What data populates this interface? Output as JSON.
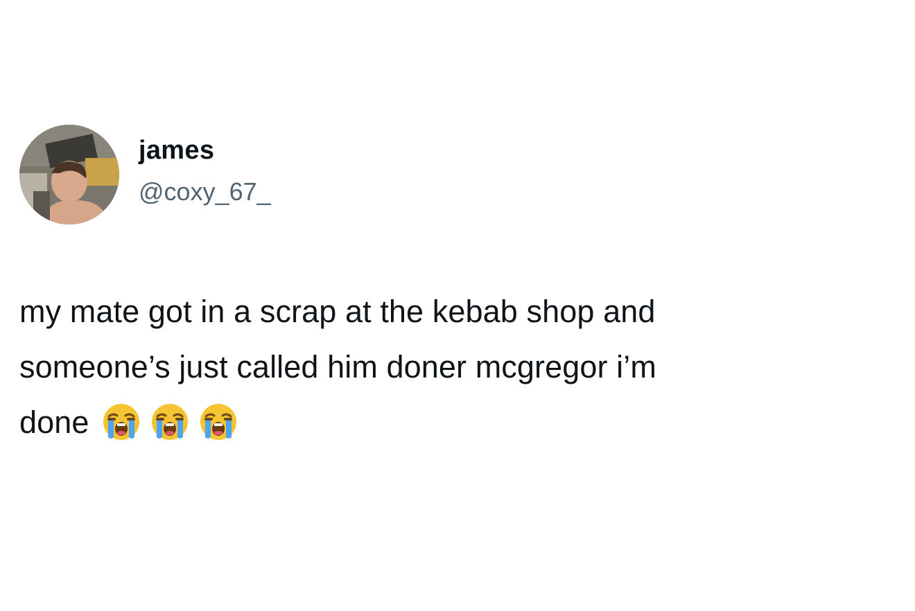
{
  "tweet": {
    "author": {
      "display_name": "james",
      "handle": "@coxy_67_"
    },
    "text_lines": [
      "my mate got in a scrap at the kebab shop and",
      "someone’s just called him doner mcgregor i’m",
      "done"
    ],
    "emojis": [
      "loudly-crying-face",
      "loudly-crying-face",
      "loudly-crying-face"
    ]
  },
  "colors": {
    "text_primary": "#0f1419",
    "text_secondary": "#536471",
    "background": "#ffffff"
  }
}
